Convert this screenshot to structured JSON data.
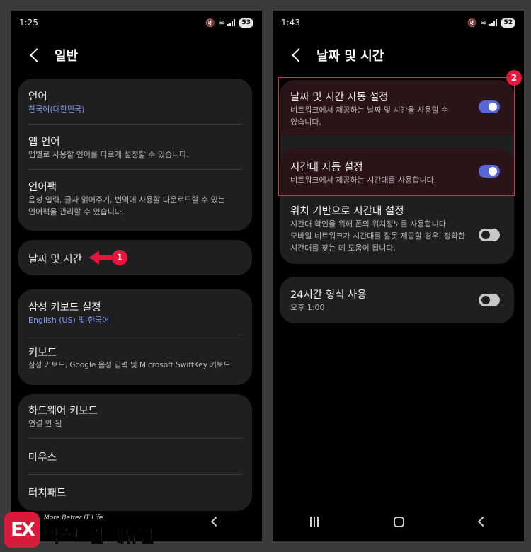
{
  "left_screen": {
    "status": {
      "time": "1:25",
      "battery": "53"
    },
    "header": {
      "title": "일반"
    },
    "card1": [
      {
        "title": "언어",
        "sub": "한국어(대한민국)"
      },
      {
        "title": "앱 언어",
        "sub": "앱별로 사용할 언어를 다르게 설정할 수 있습니다."
      },
      {
        "title": "언어팩",
        "sub1": "음성 입력, 글자 읽어주기, 번역에 사용할 다운로드할 수 있는",
        "sub2": "언어팩을 관리할 수 있습니다."
      }
    ],
    "date_time": {
      "title": "날짜 및 시간",
      "badge": "1"
    },
    "card3": [
      {
        "title": "삼성 키보드 설정",
        "sub": "English (US) 및 한국어"
      },
      {
        "title": "키보드",
        "sub": "삼성 키보드, Google 음성 입력 및 Microsoft SwiftKey 키보드"
      }
    ],
    "card4": [
      {
        "title": "하드웨어 키보드",
        "sub": "연결 안 됨"
      },
      {
        "title": "마우스"
      },
      {
        "title": "터치패드"
      }
    ]
  },
  "right_screen": {
    "status": {
      "time": "1:43",
      "battery": "52"
    },
    "header": {
      "title": "날짜 및 시간"
    },
    "badge": "2",
    "auto_datetime": {
      "title": "날짜 및 시간 자동 설정",
      "sub1": "네트워크에서 제공하는 날짜 및 시간을 사용할 수",
      "sub2": "있습니다.",
      "state": "on"
    },
    "auto_timezone": {
      "title": "시간대 자동 설정",
      "sub": "네트워크에서 제공하는 시간대를 사용합니다.",
      "state": "on"
    },
    "location_timezone": {
      "title": "위치 기반으로 시간대 설정",
      "sub1": "시간대 확인을 위해 폰의 위치정보를 사용합니다.",
      "sub2": "모바일 네트워크가 시간대를 잘못 제공할 경우, 정확한",
      "sub3": "시간대를 찾는 데 도움이 됩니다.",
      "state": "off"
    },
    "format24": {
      "title": "24시간 형식 사용",
      "sub": "오후 1:00",
      "state": "off"
    }
  },
  "watermark": {
    "tagline": "More Better IT Life",
    "name": "익스트림 매뉴얼",
    "logo": "EX"
  },
  "colors": {
    "accent_red": "#e8163c",
    "toggle_on": "#5867d8",
    "link_blue": "#7d9cf4",
    "card_bg": "#1f1f22"
  }
}
